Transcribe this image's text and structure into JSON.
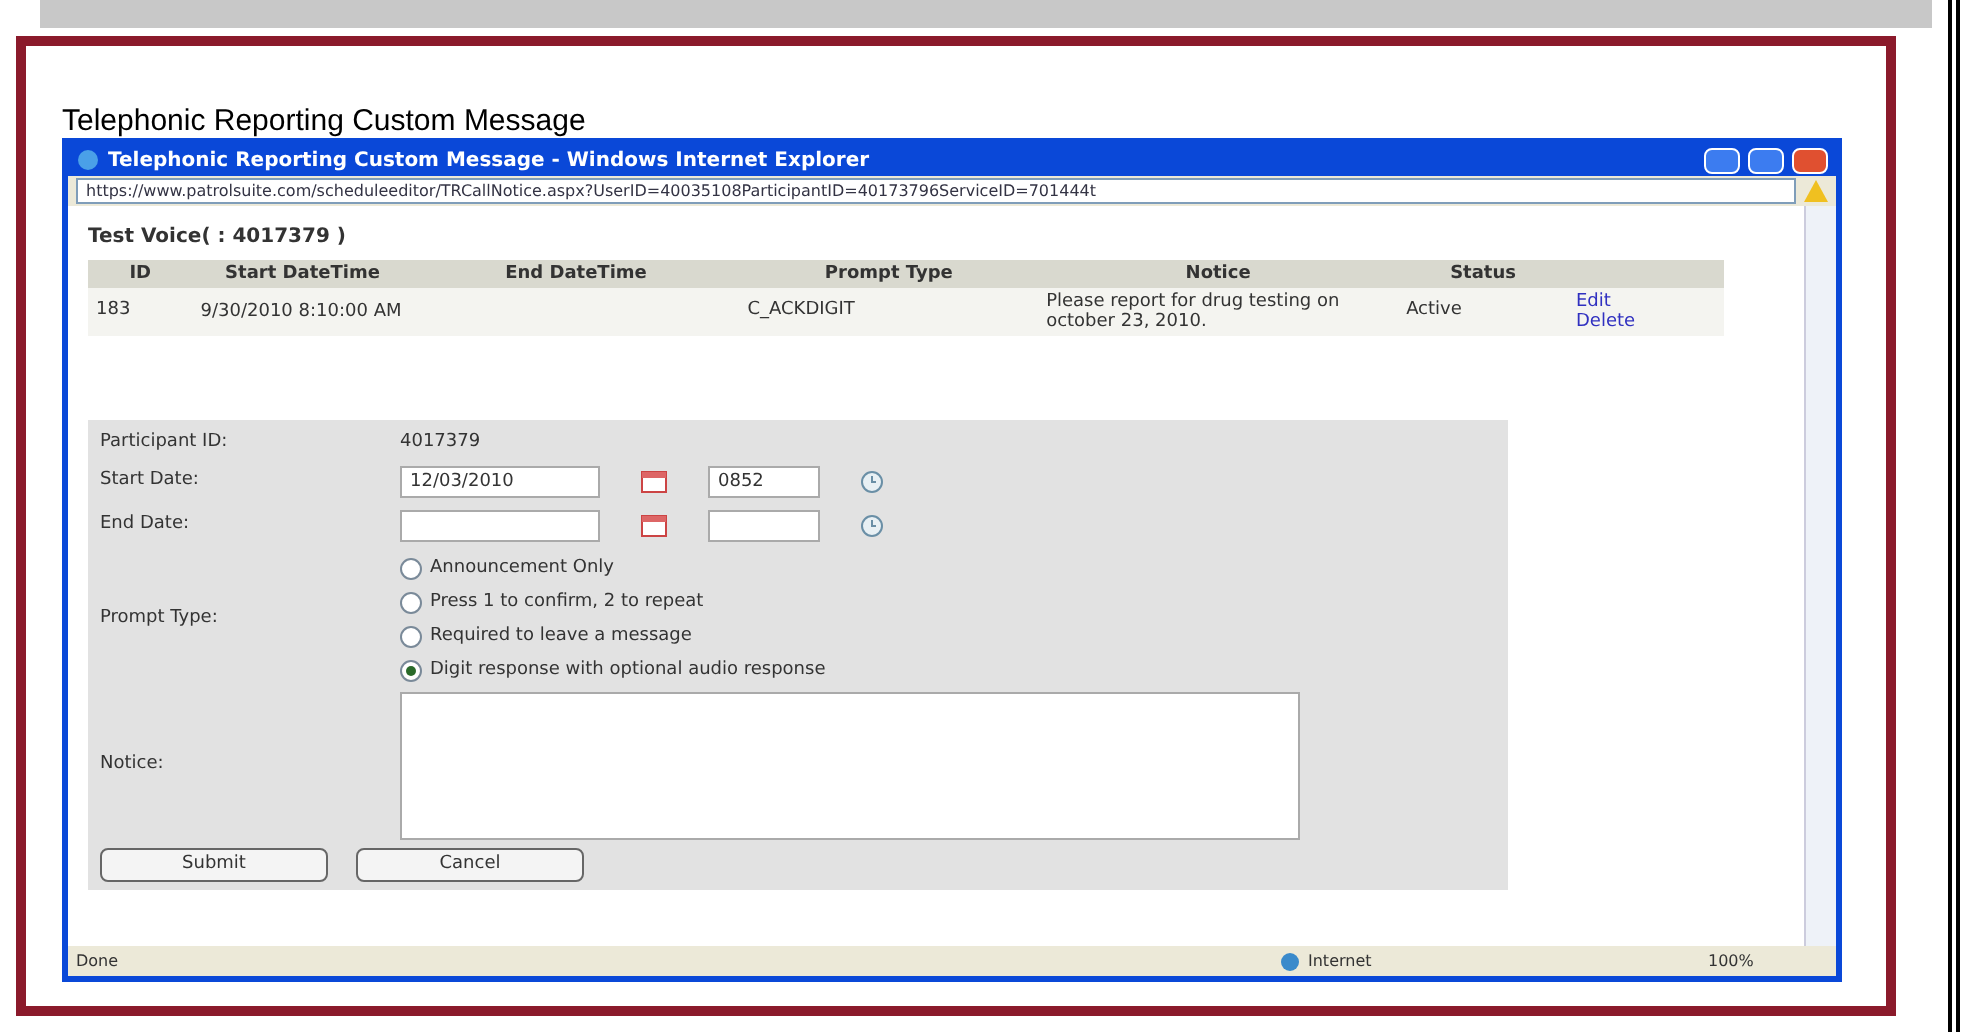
{
  "page_title": "Telephonic Reporting Custom Message",
  "window": {
    "title": "Telephonic Reporting Custom Message - Windows Internet Explorer",
    "address": "https://www.patrolsuite.com/scheduleeditor/TRCallNotice.aspx?UserID=40035108ParticipantID=40173796ServiceID=701444t"
  },
  "heading": "Test Voice( :  4017379 )",
  "table": {
    "columns": [
      "ID",
      "Start DateTime",
      "End DateTime",
      "Prompt Type",
      "Notice",
      "Status"
    ],
    "rows": [
      {
        "id": "183",
        "start": "9/30/2010 8:10:00 AM",
        "prompt_type": "C_ACKDIGIT",
        "notice": "Please report for drug testing on october 23, 2010.",
        "status": "Active",
        "actions": [
          "Edit",
          "Delete"
        ]
      }
    ]
  },
  "form": {
    "participant_label": "Participant ID:",
    "participant_id": "4017379",
    "start_label": "Start Date:",
    "start_date": "12/03/2010",
    "start_time": "0852",
    "end_label": "End Date:",
    "prompt_label": "Prompt Type:",
    "prompt_options": [
      {
        "label": "Announcement Only",
        "selected": false
      },
      {
        "label": "Press 1 to confirm, 2 to repeat",
        "selected": false
      },
      {
        "label": "Required to leave a message",
        "selected": false
      },
      {
        "label": "Digit response with optional audio response",
        "selected": true
      }
    ],
    "notice_label": "Notice:",
    "buttons": [
      "Submit",
      "Cancel"
    ]
  },
  "status_bar": {
    "text": "Done",
    "zone": "Internet",
    "zoom": "100%"
  }
}
